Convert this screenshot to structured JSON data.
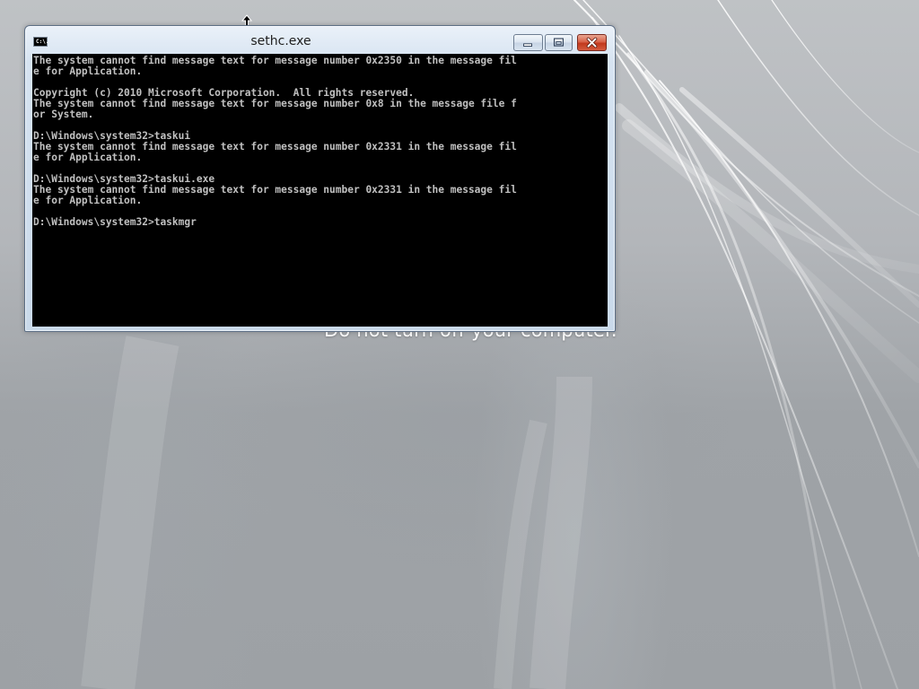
{
  "window": {
    "title": "sethc.exe",
    "icon": "console-icon",
    "icon_text": "C:\\.",
    "buttons": {
      "minimize": "minimize-icon",
      "maximize": "maximize-icon",
      "close": "close-icon"
    }
  },
  "console": {
    "lines": [
      "The system cannot find message text for message number 0x2350 in the message fil",
      "e for Application.",
      "",
      "Copyright (c) 2010 Microsoft Corporation.  All rights reserved.",
      "The system cannot find message text for message number 0x8 in the message file f",
      "or System.",
      "",
      "D:\\Windows\\system32>taskui",
      "The system cannot find message text for message number 0x2331 in the message fil",
      "e for Application.",
      "",
      "D:\\Windows\\system32>taskui.exe",
      "The system cannot find message text for message number 0x2331 in the message fil",
      "e for Application.",
      "",
      "D:\\Windows\\system32>taskmgr"
    ]
  },
  "desktop": {
    "status_text": "Do not turn off your computer."
  },
  "colors": {
    "console_background": "#000000",
    "console_text": "#c0c0c0",
    "close_button": "#c2391d"
  }
}
